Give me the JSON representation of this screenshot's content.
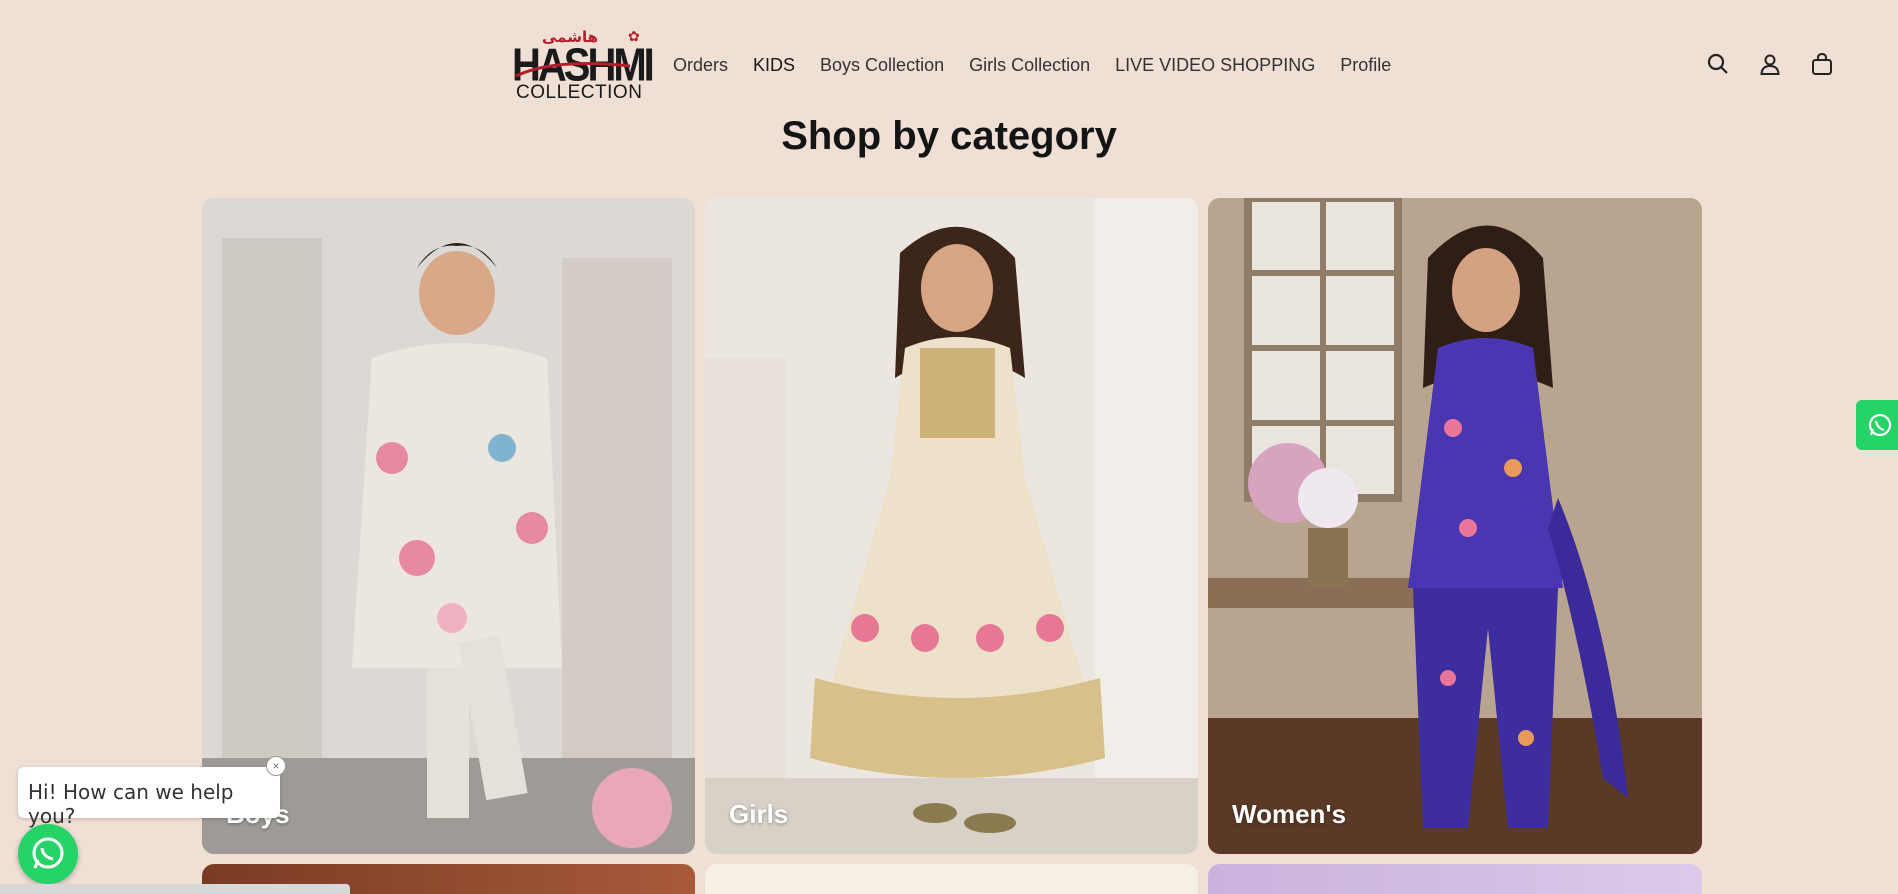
{
  "brand": {
    "urdu": "هاشمی",
    "name": "HASHMI",
    "sub": "COLLECTION"
  },
  "nav": [
    "Orders",
    "KIDS",
    "Boys Collection",
    "Girls Collection",
    "LIVE VIDEO SHOPPING",
    "Profile"
  ],
  "header_icons": [
    "search-icon",
    "account-icon",
    "cart-icon"
  ],
  "section": {
    "title": "Shop by category"
  },
  "categories": [
    {
      "label": "Boys"
    },
    {
      "label": "Girls"
    },
    {
      "label": "Women's"
    }
  ],
  "chat": {
    "greeting": "Hi! How can we help you?",
    "close": "×"
  },
  "colors": {
    "background": "#efdfd5",
    "whatsapp": "#25d366",
    "brand_red": "#b51d2a"
  }
}
